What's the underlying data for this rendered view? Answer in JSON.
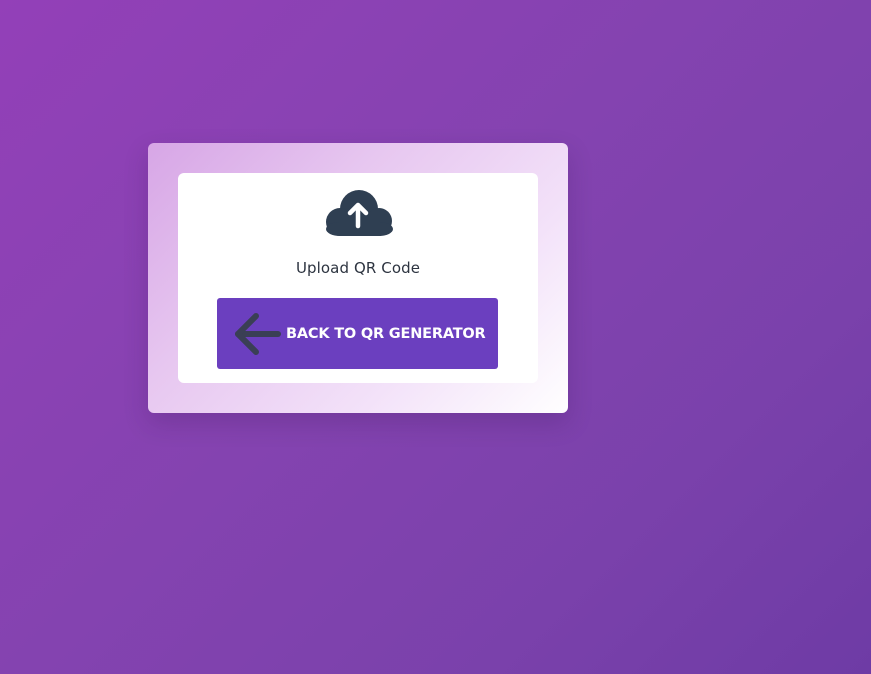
{
  "colors": {
    "background_gradient": [
      "#9340b8",
      "#6e3ba5"
    ],
    "outer_card_gradient": [
      "#d7a6e6",
      "#ffffff"
    ],
    "inner_card": "#ffffff",
    "icon": "#2f3f52",
    "button": "#6b3fbf",
    "button_text": "#ffffff",
    "label_text": "#2d3440"
  },
  "upload": {
    "icon": "cloud-upload-icon",
    "label": "Upload QR Code"
  },
  "back_button": {
    "icon": "arrow-left-icon",
    "label": "BACK TO QR GENERATOR"
  }
}
